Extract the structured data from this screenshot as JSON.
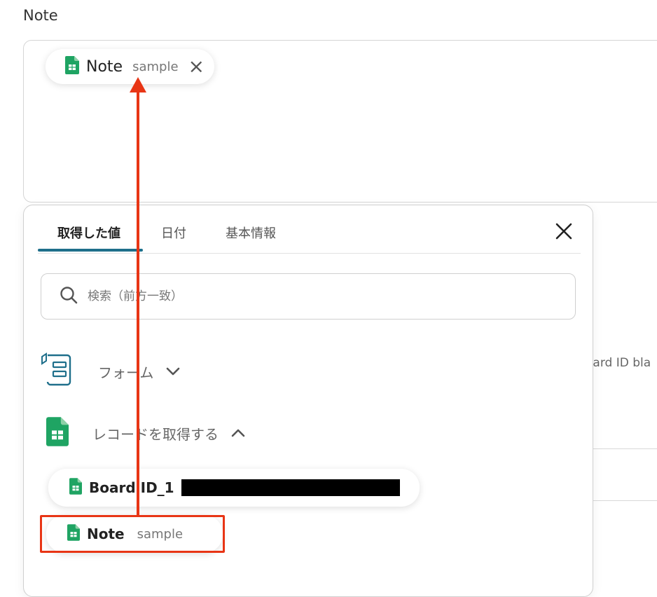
{
  "field": {
    "label": "Note"
  },
  "note_chip": {
    "title": "Note",
    "sub": "sample"
  },
  "background": {
    "text": "oard ID bla"
  },
  "popover": {
    "tabs": [
      {
        "label": "取得した値",
        "active": true
      },
      {
        "label": "日付",
        "active": false
      },
      {
        "label": "基本情報",
        "active": false
      }
    ],
    "search": {
      "placeholder": "検索（前方一致）"
    },
    "groups": [
      {
        "label": "フォーム",
        "expanded": false
      },
      {
        "label": "レコードを取得する",
        "expanded": true
      }
    ],
    "items": [
      {
        "label": "Board ID_1",
        "sub": ""
      },
      {
        "label": "Note",
        "sub": "sample"
      }
    ]
  },
  "colors": {
    "accent": "#1f6f8b",
    "highlight": "#e83515",
    "sheets_green": "#1fa463",
    "form_icon": "#1f6f8b"
  }
}
